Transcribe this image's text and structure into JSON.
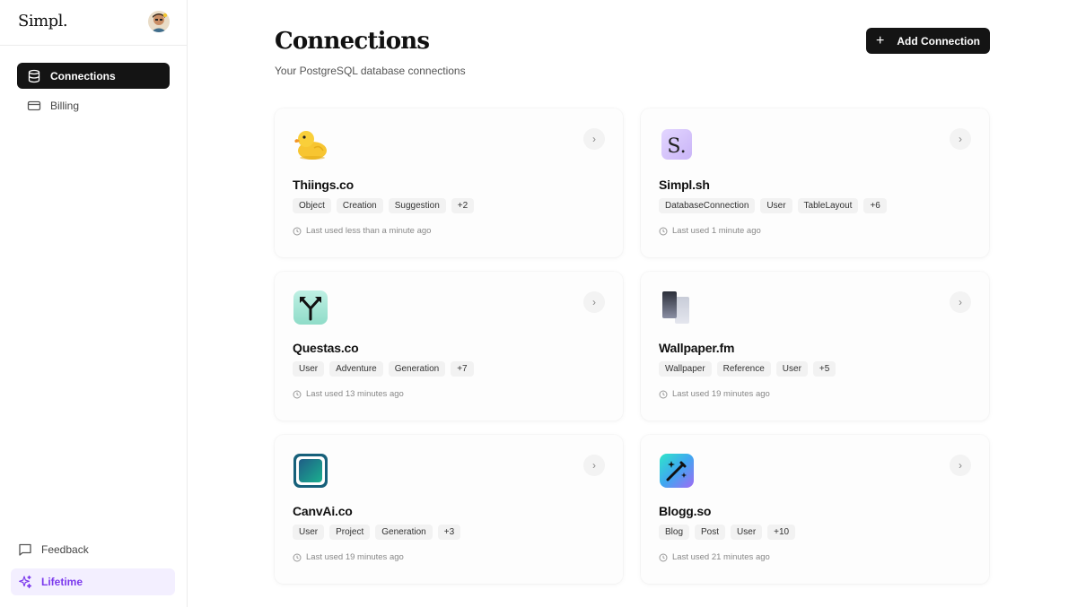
{
  "brand": "Simpl.",
  "nav": [
    {
      "label": "Connections",
      "icon": "database-icon",
      "active": true
    },
    {
      "label": "Billing",
      "icon": "credit-card-icon",
      "active": false
    }
  ],
  "bottom_nav": {
    "feedback": {
      "label": "Feedback",
      "icon": "message-square-icon"
    },
    "lifetime": {
      "label": "Lifetime",
      "icon": "sparkles-icon"
    }
  },
  "header": {
    "title": "Connections",
    "subtitle": "Your PostgreSQL database connections",
    "add_button_label": "Add Connection"
  },
  "colors": {
    "accent": "#141414",
    "lifetime": "#7c3aed"
  },
  "connections": [
    {
      "name": "Thiings.co",
      "icon": "rubber-duck-icon",
      "tags": [
        "Object",
        "Creation",
        "Suggestion",
        "+2"
      ],
      "last_used": "Last used less than a minute ago"
    },
    {
      "name": "Simpl.sh",
      "icon": "simpl-s-logo-icon",
      "tags": [
        "DatabaseConnection",
        "User",
        "TableLayout",
        "+6"
      ],
      "last_used": "Last used 1 minute ago"
    },
    {
      "name": "Questas.co",
      "icon": "split-arrow-icon",
      "tags": [
        "User",
        "Adventure",
        "Generation",
        "+7"
      ],
      "last_used": "Last used 13 minutes ago"
    },
    {
      "name": "Wallpaper.fm",
      "icon": "phone-screens-icon",
      "tags": [
        "Wallpaper",
        "Reference",
        "User",
        "+5"
      ],
      "last_used": "Last used 19 minutes ago"
    },
    {
      "name": "CanvAi.co",
      "icon": "canvas-square-icon",
      "tags": [
        "User",
        "Project",
        "Generation",
        "+3"
      ],
      "last_used": "Last used 19 minutes ago"
    },
    {
      "name": "Blogg.so",
      "icon": "magic-pen-icon",
      "tags": [
        "Blog",
        "Post",
        "User",
        "+10"
      ],
      "last_used": "Last used 21 minutes ago"
    }
  ]
}
